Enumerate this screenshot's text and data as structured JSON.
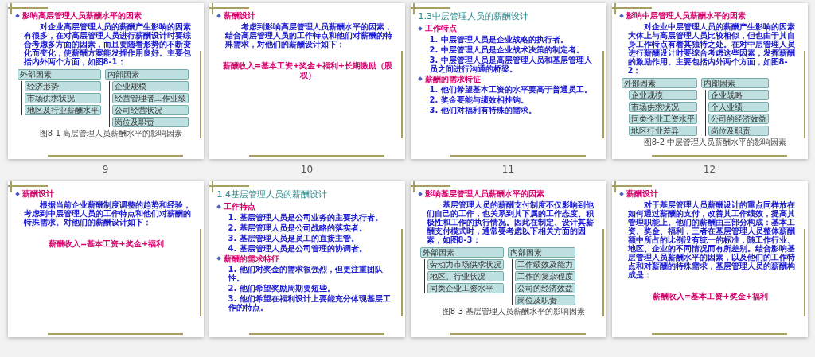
{
  "slides": [
    {
      "number": "9",
      "blocks": [
        {
          "kind": "heading",
          "text": "影响高层管理人员薪酬水平的因素"
        },
        {
          "kind": "paragraph",
          "text": "对企业高层管理人员的薪酬产生影响的因素有很多，在对高层管理人员进行薪酬设计时要综合考虑多方面的因素，而且要随着形势的不断变化而变化，使薪酬方案能发挥作用良好。主要包括内外两个方面，如图8-1："
        },
        {
          "kind": "diagram",
          "left": {
            "header": "外部因素",
            "items": [
              "经济形势",
              "市场供求状况",
              "地区及行业薪酬水平"
            ]
          },
          "right": {
            "header": "内部因素",
            "items": [
              "企业规模",
              "经营管理者工作业绩",
              "公司经营状况",
              "岗位及职责"
            ]
          },
          "caption": "图8-1 高层管理人员薪酬水平的影响因素"
        }
      ]
    },
    {
      "number": "10",
      "blocks": [
        {
          "kind": "heading",
          "text": "薪酬设计"
        },
        {
          "kind": "paragraph",
          "text": "考虑到影响高层管理人员薪酬水平的因素，结合高层管理人员的工作特点和他们对薪酬的特殊需求，对他们的薪酬设计如下："
        },
        {
          "kind": "formula",
          "text": "薪酬收入=基本工资+奖金+福利+长期激励（股权）"
        }
      ]
    },
    {
      "number": "11",
      "blocks": [
        {
          "kind": "title",
          "text": "1.3中层管理人员的薪酬设计"
        },
        {
          "kind": "heading",
          "text": "工作特点"
        },
        {
          "kind": "item",
          "text": "1. 中层管理人员是企业战略的执行者。"
        },
        {
          "kind": "item",
          "text": "2. 中层管理人员是企业战术决策的制定者。"
        },
        {
          "kind": "item",
          "text": "3. 中层管理人员是高层管理人员和基层管理人员之间进行沟通的桥梁。"
        },
        {
          "kind": "heading",
          "text": "薪酬的需求特征"
        },
        {
          "kind": "item",
          "text": "1. 他们希望基本工资的水平要高于普通员工。"
        },
        {
          "kind": "item",
          "text": "2. 奖金要能与绩效相挂钩。"
        },
        {
          "kind": "item",
          "text": "3. 他们对福利有特殊的需求。"
        }
      ]
    },
    {
      "number": "12",
      "blocks": [
        {
          "kind": "heading",
          "text": "影响中层管理人员薪酬水平的因素"
        },
        {
          "kind": "paragraph",
          "text": "对企业中层管理人员的薪酬产生影响的因素大体上与高层管理人员比较相似，但也由于其自身工作特点有着其独特之处。在对中层管理人员进行薪酬设计时要综合考虑这些因素，发挥薪酬的激励作用。主要包括内外两个方面，如图8-2："
        },
        {
          "kind": "diagram",
          "left": {
            "header": "外部因素",
            "items": [
              "企业规模",
              "市场供求状况",
              "同类企业工资水平",
              "地区行业差异"
            ]
          },
          "right": {
            "header": "内部因素",
            "items": [
              "企业战略",
              "个人业绩",
              "公司的经济效益",
              "岗位及职责"
            ]
          },
          "caption": "图8-2 中层管理人员薪酬水平的影响因素"
        }
      ]
    },
    {
      "blocks": [
        {
          "kind": "heading",
          "text": "薪酬设计"
        },
        {
          "kind": "paragraph",
          "text": "根据当前企业薪酬制度调整的趋势和经验，考虑到中层管理人员的工作特点和他们对薪酬的特殊需求。对他们的薪酬设计如下："
        },
        {
          "kind": "formula",
          "text": "薪酬收入=基本工资+奖金+福利"
        }
      ]
    },
    {
      "blocks": [
        {
          "kind": "title",
          "text": "1.4基层管理人员的薪酬设计"
        },
        {
          "kind": "heading",
          "text": "工作特点"
        },
        {
          "kind": "item",
          "text": "1. 基层管理人员是公司业务的主要执行者。"
        },
        {
          "kind": "item",
          "text": "2. 基层管理人员是公司战略的落实者。"
        },
        {
          "kind": "item",
          "text": "3. 基层管理人员是员工的直接主管。"
        },
        {
          "kind": "item",
          "text": "4. 基层管理人员是公司管理的协调者。"
        },
        {
          "kind": "heading",
          "text": "薪酬的需求特征"
        },
        {
          "kind": "item",
          "text": "1. 他们对奖金的需求很强烈，但更注重团队性。"
        },
        {
          "kind": "item",
          "text": "2. 他们希望奖励周期要短些。"
        },
        {
          "kind": "item",
          "text": "3. 他们希望在福利设计上要能充分体现基层工作的特点。"
        }
      ]
    },
    {
      "blocks": [
        {
          "kind": "heading",
          "text": "影响基层管理人员薪酬水平的因素"
        },
        {
          "kind": "paragraph",
          "text": "基层管理人员的薪酬支付制度不仅影响到他们自己的工作，也关系到其下属的工作态度、积极性和工作的执行情况。因此在制定、设计其薪酬支付模式时，通常要考虑以下相关方面的因素，如图8-3："
        },
        {
          "kind": "diagram",
          "left": {
            "header": "外部因素",
            "items": [
              "劳动力市场供求状况",
              "地区、行业状况",
              "同类企业工资水平"
            ]
          },
          "right": {
            "header": "内部因素",
            "items": [
              "工作绩效及能力",
              "工作的复杂程度",
              "公司的经济效益",
              "岗位及职责"
            ]
          },
          "caption": "图8-3 基层管理人员薪酬水平的影响因素"
        }
      ]
    },
    {
      "blocks": [
        {
          "kind": "heading",
          "text": "薪酬设计"
        },
        {
          "kind": "paragraph",
          "text": "对于基层管理人员薪酬设计的重点同样放在如何通过薪酬的支付，改善其工作绩效，提高其管理职能上。他们的薪酬由三部分构成：基本工资、奖金、福利，三者在基层管理人员整体薪酬额中所占的比例没有统一的标准，随工作行业、地区、企业的不同情况而有所差别。结合影响基层管理人员薪酬水平的因素，以及他们的工作特点和对薪酬的特殊需求，基层管理人员的薪酬构成是："
        },
        {
          "kind": "formula",
          "text": "薪酬收入=基本工资+奖金+福利"
        }
      ]
    }
  ]
}
